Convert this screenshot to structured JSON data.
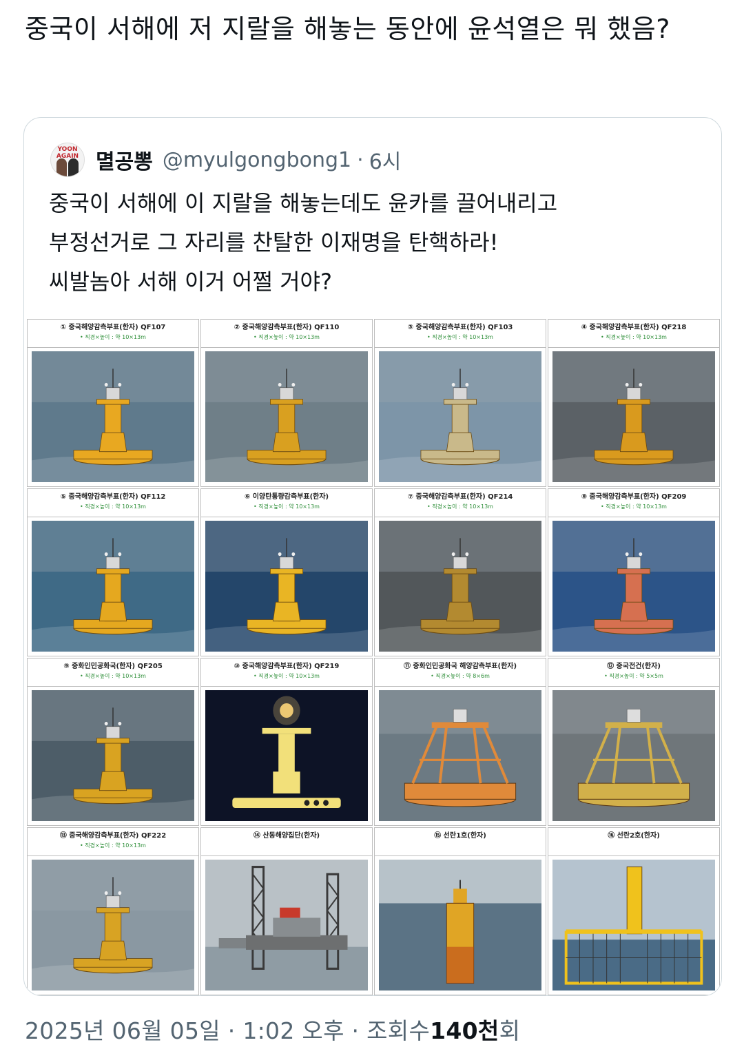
{
  "tweet": {
    "text": "중국이 서해에 저 지랄을 해놓는 동안에 윤석열은 뭐 했음?"
  },
  "quote": {
    "author": "멸공뽕",
    "handle": "@myulgongbong1",
    "separator": "·",
    "time": "6시",
    "avatar_badge": "YOON AGAIN",
    "lines": [
      "중국이 서해에 이 지랄을 해놓는데도 윤카를 끌어내리고",
      "부정선거로 그 자리를 찬탈한 이재명을 탄핵하라!",
      "씨발놈아 서해 이거 어쩔 거야?"
    ]
  },
  "grid": {
    "cells": [
      {
        "title": "① 중국해양감측부표(한자) QF107",
        "spec": "• 직경×높이 : 약 10×13m",
        "scene": "buoy",
        "color": "#e8a821",
        "water": "#5f7a8c"
      },
      {
        "title": "② 중국해양감측부표(한자) QF110",
        "spec": "• 직경×높이 : 약 10×13m",
        "scene": "buoy",
        "color": "#d9a020",
        "water": "#6f7f88"
      },
      {
        "title": "③ 중국해양감측부표(한자) QF103",
        "spec": "• 직경×높이 : 약 10×13m",
        "scene": "buoy",
        "color": "#c9b98a",
        "water": "#7d95a8"
      },
      {
        "title": "④ 중국해양감측부표(한자) QF218",
        "spec": "• 직경×높이 : 약 10×13m",
        "scene": "buoy",
        "color": "#d99a1e",
        "water": "#5b6166"
      },
      {
        "title": "⑤ 중국해양감측부표(한자) QF112",
        "spec": "• 직경×높이 : 약 10×13m",
        "scene": "buoy",
        "color": "#e5a81f",
        "water": "#3f6a86"
      },
      {
        "title": "⑥ 이양탄통량감측부표(한자)",
        "spec": "• 직경×높이 : 약 10×13m",
        "scene": "buoy",
        "color": "#e9b524",
        "water": "#24466a"
      },
      {
        "title": "⑦ 중국해양감측부표(한자) QF214",
        "spec": "• 직경×높이 : 약 10×13m",
        "scene": "buoy",
        "color": "#b38a30",
        "water": "#52575a"
      },
      {
        "title": "⑧ 중국해양감측부표(한자) QF209",
        "spec": "• 직경×높이 : 약 10×13m",
        "scene": "buoy",
        "color": "#d67050",
        "water": "#2c5488"
      },
      {
        "title": "⑨ 중화인민공화국(한자) QF205",
        "spec": "• 직경×높이 : 약 10×13m",
        "scene": "buoy",
        "color": "#d9a321",
        "water": "#4d5d68"
      },
      {
        "title": "⑩ 중국해양감측부표(한자) QF219",
        "spec": "• 직경×높이 : 약 10×13m",
        "scene": "night",
        "color": "#f2e07a",
        "water": "#0d1326"
      },
      {
        "title": "⑪ 중화인민공화국 해양감측부표(한자)",
        "spec": "• 직경×높이 : 약 8×6m",
        "scene": "cage",
        "color": "#e08a3a",
        "water": "#6c7a83"
      },
      {
        "title": "⑫ 중국전건(한자)",
        "spec": "• 직경×높이 : 약 5×5m",
        "scene": "cage",
        "color": "#d2b04a",
        "water": "#6f767a"
      },
      {
        "title": "⑬ 중국해양감측부표(한자) QF222",
        "spec": "• 직경×높이 : 약 10×13m",
        "scene": "buoy",
        "color": "#d8a323",
        "water": "#8a98a2"
      },
      {
        "title": "⑭ 산동해양집단(한자)",
        "spec": "",
        "scene": "rig",
        "color": "#3a3a3a",
        "water": "#8f9ca4"
      },
      {
        "title": "⑮ 선란1호(한자)",
        "spec": "",
        "scene": "tower",
        "color": "#e0a525",
        "water": "#5b7385"
      },
      {
        "title": "⑯ 선란2호(한자)",
        "spec": "",
        "scene": "frame",
        "color": "#f0c21c",
        "water": "#4a6b86"
      }
    ]
  },
  "footer": {
    "date": "2025년 06월 05일",
    "sep": "·",
    "time": "1:02 오후",
    "views_label": "조회수",
    "views_count": "140천",
    "views_suffix": "회"
  }
}
